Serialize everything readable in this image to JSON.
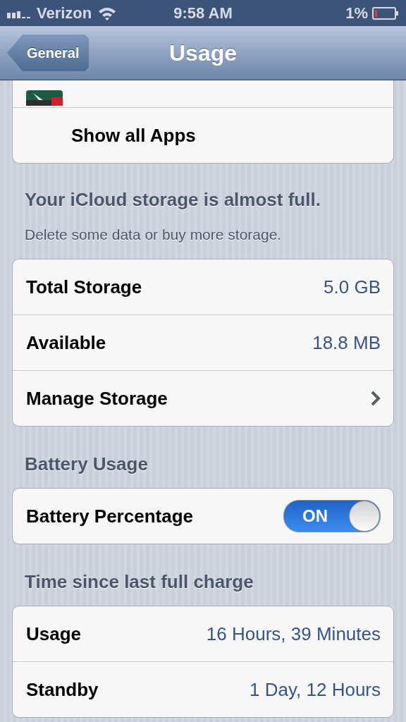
{
  "status_bar": {
    "carrier": "Verizon",
    "time": "9:58 AM",
    "battery": "1%"
  },
  "nav_bar": {
    "back": "General",
    "title": "Usage"
  },
  "apps_card": {
    "show_all": "Show all Apps"
  },
  "icloud": {
    "title": "Your iCloud storage is almost full.",
    "note": "Delete some data or buy more storage.",
    "rows": [
      {
        "label": "Total Storage",
        "value": "5.0 GB",
        "kind": "value"
      },
      {
        "label": "Available",
        "value": "18.8 MB",
        "kind": "value"
      },
      {
        "label": "Manage Storage",
        "kind": "link"
      }
    ]
  },
  "battery": {
    "title": "Battery Usage",
    "rows": [
      {
        "label": "Battery Percentage",
        "kind": "toggle",
        "on": true,
        "switch_text": "ON"
      }
    ]
  },
  "charge": {
    "title": "Time since last full charge",
    "rows": [
      {
        "label": "Usage",
        "value": "16 Hours, 39 Minutes",
        "kind": "value"
      },
      {
        "label": "Standby",
        "value": "1 Day, 12 Hours",
        "kind": "value"
      }
    ]
  }
}
